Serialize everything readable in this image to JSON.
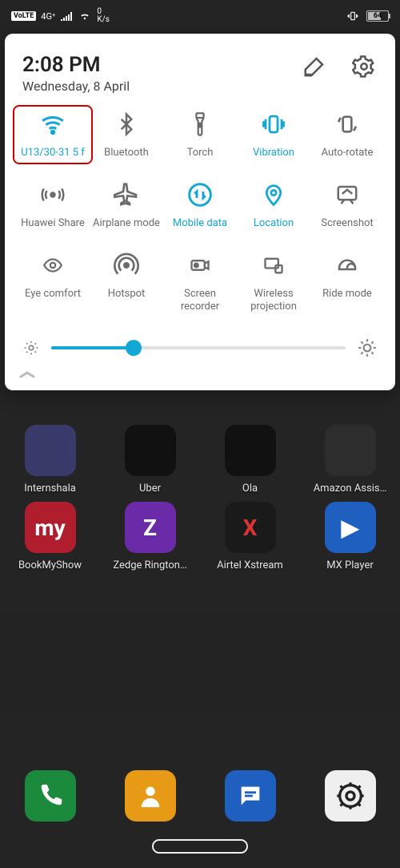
{
  "status": {
    "volte": "VoLTE",
    "net_gen": "4G⁺",
    "speed_value": "0",
    "speed_unit": "K/s",
    "battery_pct": "64"
  },
  "panel": {
    "time": "2:08 PM",
    "date": "Wednesday, 8 April",
    "brightness_pct": 28
  },
  "tiles": [
    {
      "id": "wifi",
      "label": "U13/30-31 5 f",
      "icon": "wifi-icon",
      "active": true,
      "highlight": true
    },
    {
      "id": "bluetooth",
      "label": "Bluetooth",
      "icon": "bluetooth-icon",
      "active": false
    },
    {
      "id": "torch",
      "label": "Torch",
      "icon": "torch-icon",
      "active": false
    },
    {
      "id": "vibration",
      "label": "Vibration",
      "icon": "vibration-icon",
      "active": true
    },
    {
      "id": "autorotate",
      "label": "Auto-rotate",
      "icon": "autorotate-icon",
      "active": false
    },
    {
      "id": "huaweishare",
      "label": "Huawei Share",
      "icon": "huaweishare-icon",
      "active": false
    },
    {
      "id": "airplane",
      "label": "Airplane mode",
      "icon": "airplane-icon",
      "active": false
    },
    {
      "id": "mobiledata",
      "label": "Mobile data",
      "icon": "mobiledata-icon",
      "active": true
    },
    {
      "id": "location",
      "label": "Location",
      "icon": "location-icon",
      "active": true
    },
    {
      "id": "screenshot",
      "label": "Screenshot",
      "icon": "screenshot-icon",
      "active": false
    },
    {
      "id": "eyecomfort",
      "label": "Eye comfort",
      "icon": "eye-icon",
      "active": false
    },
    {
      "id": "hotspot",
      "label": "Hotspot",
      "icon": "hotspot-icon",
      "active": false
    },
    {
      "id": "recorder",
      "label": "Screen recorder",
      "icon": "recorder-icon",
      "active": false
    },
    {
      "id": "projection",
      "label": "Wireless projection",
      "icon": "projection-icon",
      "active": false
    },
    {
      "id": "ridemode",
      "label": "Ride mode",
      "icon": "helmet-icon",
      "active": false
    }
  ],
  "home": {
    "row_a": [
      {
        "label": "Internshala",
        "bg": "#3a3a6a"
      },
      {
        "label": "Uber",
        "bg": "#111111"
      },
      {
        "label": "Ola",
        "bg": "#111111"
      },
      {
        "label": "Amazon Assis…",
        "bg": "#2d2d2d"
      }
    ],
    "row_b": [
      {
        "label": "BookMyShow",
        "bg": "#b01e2e",
        "glyph": "my"
      },
      {
        "label": "Zedge Rington…",
        "bg": "#6b2aa8",
        "glyph": "Z"
      },
      {
        "label": "Airtel Xstream",
        "bg": "#1a1a1a",
        "glyph": "X",
        "glyph_color": "#d33"
      },
      {
        "label": "MX Player",
        "bg": "#1f5fbf",
        "glyph": "▶"
      }
    ],
    "dock": [
      {
        "label": "",
        "bg": "#1c8a3c",
        "glyph": "phone"
      },
      {
        "label": "",
        "bg": "#e69a16",
        "glyph": "contact"
      },
      {
        "label": "",
        "bg": "#1f5fbf",
        "glyph": "chat"
      },
      {
        "label": "",
        "bg": "#efefef",
        "glyph": "gear"
      }
    ]
  }
}
